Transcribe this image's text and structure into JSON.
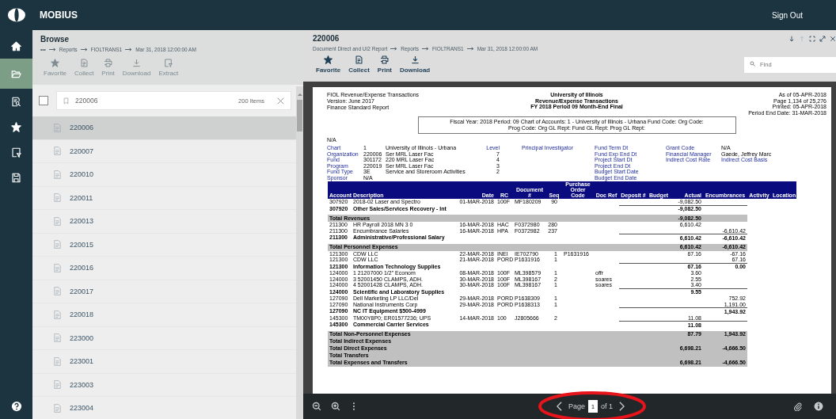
{
  "topbar": {
    "brand": "MOBIUS",
    "sign_out": "Sign Out"
  },
  "rail": [
    {
      "kind": "home",
      "selected": false
    },
    {
      "kind": "folder",
      "selected": true
    },
    {
      "kind": "search",
      "selected": false
    },
    {
      "kind": "star",
      "selected": false
    },
    {
      "kind": "filter",
      "selected": false
    },
    {
      "kind": "save",
      "selected": false
    }
  ],
  "browse": {
    "title": "Browse",
    "breadcrumb": [
      "•••",
      "Reports",
      "FIOLTRANS1",
      "Mar 31, 2018 12:00:00 AM"
    ],
    "toolbar": [
      {
        "kind": "favorite",
        "label": "Favorite",
        "disabled": true
      },
      {
        "kind": "collect",
        "label": "Collect",
        "disabled": true
      },
      {
        "kind": "print",
        "label": "Print",
        "disabled": true
      },
      {
        "kind": "download",
        "label": "Download",
        "disabled": true
      },
      {
        "kind": "extract",
        "label": "Extract",
        "disabled": true
      }
    ],
    "filter": {
      "checked": false,
      "value": "220006",
      "count": "200 Items"
    },
    "items": [
      {
        "label": "220006",
        "selected": true
      },
      {
        "label": "220007",
        "selected": false
      },
      {
        "label": "220010",
        "selected": false
      },
      {
        "label": "220011",
        "selected": false
      },
      {
        "label": "220013",
        "selected": false
      },
      {
        "label": "220015",
        "selected": false
      },
      {
        "label": "220016",
        "selected": false
      },
      {
        "label": "220017",
        "selected": false
      },
      {
        "label": "220018",
        "selected": false
      },
      {
        "label": "223000",
        "selected": false
      },
      {
        "label": "223001",
        "selected": false
      },
      {
        "label": "223003",
        "selected": false
      },
      {
        "label": "223004",
        "selected": false
      }
    ]
  },
  "viewer": {
    "title": "220006",
    "breadcrumb": [
      "Document Direct and UI2 Report",
      "Reports",
      "FIOLTRANS1",
      "Mar 31, 2018 12:00:00 AM"
    ],
    "toolbar": [
      {
        "kind": "favorite",
        "label": "Favorite",
        "disabled": false
      },
      {
        "kind": "collect",
        "label": "Collect",
        "disabled": false
      },
      {
        "kind": "print",
        "label": "Print",
        "disabled": false
      },
      {
        "kind": "download",
        "label": "Download",
        "disabled": false
      }
    ],
    "window_controls": [
      {
        "kind": "down",
        "disabled": false
      },
      {
        "kind": "up",
        "disabled": true
      },
      {
        "kind": "fullscreen",
        "disabled": false
      },
      {
        "kind": "expand",
        "disabled": false
      },
      {
        "kind": "close",
        "disabled": false
      }
    ],
    "find": {
      "placeholder": "Find"
    },
    "pager": {
      "label": "Page",
      "value": "1",
      "of": "of 1"
    }
  },
  "report": {
    "left": [
      "FIOL Revenue/Expense Transactions",
      "Version: June 2017",
      "Finance Standard Report"
    ],
    "center": [
      "University of Illinois",
      "Revenue/Expense Transactions",
      "FY 2018  Period 09 Month-End Final"
    ],
    "right": [
      "As of 05-APR-2018",
      "Page 1,134 of 25,276",
      "Printed: 05-APR-2018",
      "Period End Date: 31-MAR-2018"
    ],
    "criteria": [
      "Fiscal Year: 2018 Period: 09 Chart of Accounts: 1 - University of Illinois - Urbana Fund Code:  Org Code:",
      "Prog Code:  Org GL Rept:  Fund GL Rept:  Prog GL Rept:"
    ],
    "note": "N/A",
    "info": [
      {
        "label": "Chart",
        "code": "1",
        "name": "University of Illinois - Urbana",
        "level_label": "Level",
        "pi_label": "Principal Investigator",
        "date_label": "Fund Term Dt",
        "right_label": "Grant Code",
        "right_value": "N/A"
      },
      {
        "label": "Organization",
        "code": "220006",
        "name": "Ser MRL Laser Fac",
        "level": "7",
        "date_label": "Fund Exp End Dt",
        "right_label": "Financial Manager",
        "right_value": "Gaede, Jeffrey Marc"
      },
      {
        "label": "Fund",
        "code": "301172",
        "name": "220 MRL Laser Fac",
        "level": "4",
        "date_label": "Project Start Dt",
        "right_label": "Indirect Cost Rate",
        "right_label2": "Indirect Cost Basis"
      },
      {
        "label": "Program",
        "code": "220019",
        "name": "Ser MRL Laser Fac",
        "level": "3",
        "date_label": "Project End Dt"
      },
      {
        "label": "Fund Type",
        "code": "3E",
        "name": "Service and Storeroom Activities",
        "level": "2",
        "date_label": "Budget Start Date"
      },
      {
        "label": "Sponsor",
        "code": "N/A",
        "date_label": "Budget End Date"
      }
    ],
    "columns": [
      "Account",
      "Description",
      "Date",
      "RC",
      "Document #",
      "Seq",
      "Purchase Order Code",
      "Doc Ref",
      "Deposit #",
      "Budget",
      "Actual",
      "Encumbrances",
      "Activity",
      "Location"
    ],
    "rows": [
      {
        "kind": "line",
        "account": "307920",
        "description": "2018-02 Laser and Spectro",
        "date": "01-MAR-2018",
        "rc": "100F",
        "document": "MF180209",
        "seq": "90",
        "actual": "-9,082.50"
      },
      {
        "kind": "subtotal",
        "account": "307920",
        "description": "Other Sales/Services Recovery - Int",
        "actual": "-9,082.50"
      },
      {
        "kind": "total",
        "label": "Total Revenues",
        "actual": "-9,082.50"
      },
      {
        "kind": "line",
        "account": "211300",
        "description": "HR Payroll 2018 MN 3 0",
        "date": "16-MAR-2018",
        "rc": "HAC",
        "document": "F0372980",
        "seq": "280",
        "actual": "6,610.42"
      },
      {
        "kind": "line",
        "account": "211300",
        "description": "Encumbrance Salaries",
        "date": "16-MAR-2018",
        "rc": "HPA",
        "document": "F0372982",
        "seq": "237",
        "encumbrances": "-6,610.42"
      },
      {
        "kind": "subtotal",
        "account": "211300",
        "description": "Administrative/Professional Salary",
        "actual": "6,610.42",
        "encumbrances": "-6,610.42"
      },
      {
        "kind": "total",
        "label": "Total Personnel Expenses",
        "actual": "6,610.42",
        "encumbrances": "-6,610.42"
      },
      {
        "kind": "line",
        "account": "121300",
        "description": "CDW LLC",
        "date": "22-MAR-2018",
        "rc": "INEI",
        "document": "IE702790",
        "seq": "1",
        "po_code": "P1631916",
        "actual": "67.16",
        "encumbrances": "-67.16"
      },
      {
        "kind": "line",
        "account": "121300",
        "description": "CDW LLC",
        "date": "21-MAR-2018",
        "rc": "PORD",
        "document": "P1631916",
        "seq": "1",
        "encumbrances": "67.16"
      },
      {
        "kind": "subtotal",
        "account": "121300",
        "description": "Information Technology Supplies",
        "actual": "67.16",
        "encumbrances": "0.00"
      },
      {
        "kind": "line",
        "account": "124000",
        "description": "1  21207000 1/2\"  Econom",
        "date": "08-MAR-2018",
        "rc": "100F",
        "document": "ML398579",
        "seq": "1",
        "doc_ref": "offr",
        "actual": "3.60"
      },
      {
        "kind": "line",
        "account": "124000",
        "description": "3  52001450 CLAMPS, ADH.",
        "date": "30-MAR-2018",
        "rc": "100F",
        "document": "ML398167",
        "seq": "2",
        "doc_ref": "soares",
        "actual": "2.55"
      },
      {
        "kind": "line",
        "account": "124000",
        "description": "4  52001428 CLAMPS, ADH.",
        "date": "30-MAR-2018",
        "rc": "100F",
        "document": "ML398167",
        "seq": "1",
        "doc_ref": "soares",
        "actual": "3.40"
      },
      {
        "kind": "subtotal",
        "account": "124000",
        "description": "Scientific and Laboratory Supplies",
        "actual": "9.55"
      },
      {
        "kind": "line",
        "account": "127090",
        "description": "Dell Marketing LP LLC/Del",
        "date": "29-MAR-2018",
        "rc": "PORD",
        "document": "P1638309",
        "seq": "1",
        "encumbrances": "752.92"
      },
      {
        "kind": "line",
        "account": "127090",
        "description": "National Instruments Corp",
        "date": "29-MAR-2018",
        "rc": "PORD",
        "document": "P1638313",
        "seq": "1",
        "encumbrances": "1,191.00"
      },
      {
        "kind": "subtotal",
        "account": "127090",
        "description": "NC IT Equipment $500-4999",
        "encumbrances": "1,943.92"
      },
      {
        "kind": "line",
        "account": "145300",
        "description": "TM00Y8P0; ER01577236; UPS",
        "date": "14-MAR-2018",
        "rc": "100",
        "document": "J2805666",
        "seq": "2",
        "actual": "11.08"
      },
      {
        "kind": "subtotal",
        "account": "145300",
        "description": "Commercial Carrier Services",
        "actual": "11.08"
      },
      {
        "kind": "total",
        "label": "Total Non-Personnel Expenses",
        "actual": "87.79",
        "encumbrances": "1,943.92"
      },
      {
        "kind": "total",
        "label": "Total Indirect Expenses"
      },
      {
        "kind": "total",
        "label": "Total Direct Expenses",
        "actual": "6,698.21",
        "encumbrances": "-4,666.50"
      },
      {
        "kind": "total",
        "label": "Total Transfers"
      },
      {
        "kind": "total",
        "label": "Total Expenses and Transfers",
        "actual": "6,698.21",
        "encumbrances": "-4,666.50"
      }
    ]
  }
}
